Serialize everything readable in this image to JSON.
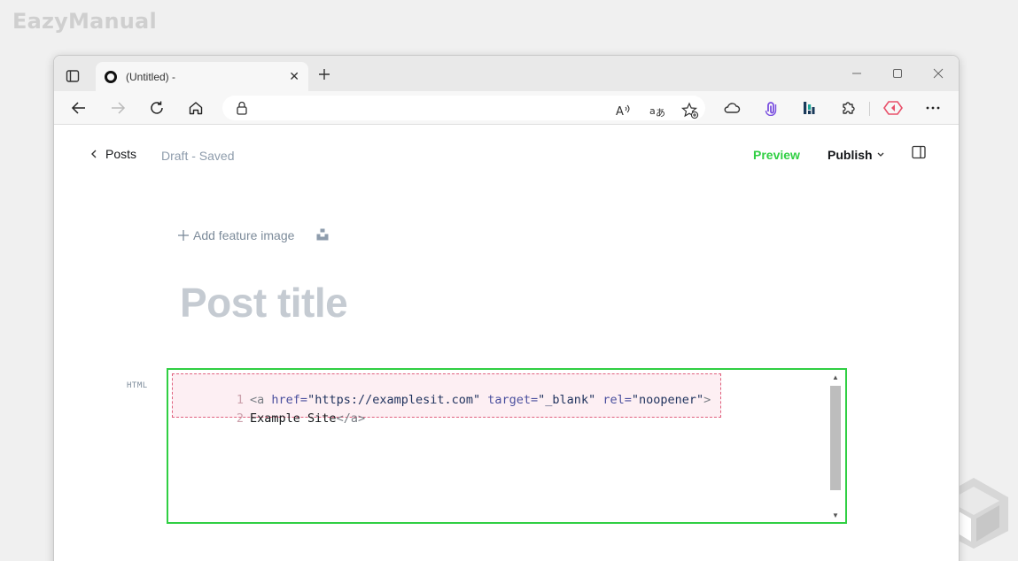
{
  "watermark": {
    "text": "EazyManual"
  },
  "browser": {
    "tab": {
      "title": "(Untitled) -",
      "close": "✕"
    },
    "new_tab": "+",
    "window_controls": {
      "minimize": "—",
      "maximize": "☐",
      "close": "✕"
    }
  },
  "editor": {
    "header": {
      "back_label": "Posts",
      "status": "Draft - Saved",
      "preview_label": "Preview",
      "publish_label": "Publish"
    },
    "feature_image": {
      "label": "Add feature image"
    },
    "title_placeholder": "Post title",
    "html_card": {
      "label": "HTML",
      "lines": [
        {
          "number": "1",
          "tokens": [
            {
              "type": "tag",
              "text": "<a "
            },
            {
              "type": "attr",
              "text": "href="
            },
            {
              "type": "val",
              "text": "\"https://examplesit.com\" "
            },
            {
              "type": "attr",
              "text": "target="
            },
            {
              "type": "val",
              "text": "\"_blank\" "
            },
            {
              "type": "attr",
              "text": "rel="
            },
            {
              "type": "val",
              "text": "\"noopener\""
            },
            {
              "type": "tag",
              "text": ">"
            }
          ]
        },
        {
          "number": "2",
          "tokens": [
            {
              "type": "text",
              "text": "Example Site"
            },
            {
              "type": "tag",
              "text": "</a>"
            }
          ]
        }
      ]
    }
  },
  "colors": {
    "accent_green": "#30cf43",
    "selection_pink": "#e0607e",
    "title_placeholder": "#c5cbd2"
  }
}
